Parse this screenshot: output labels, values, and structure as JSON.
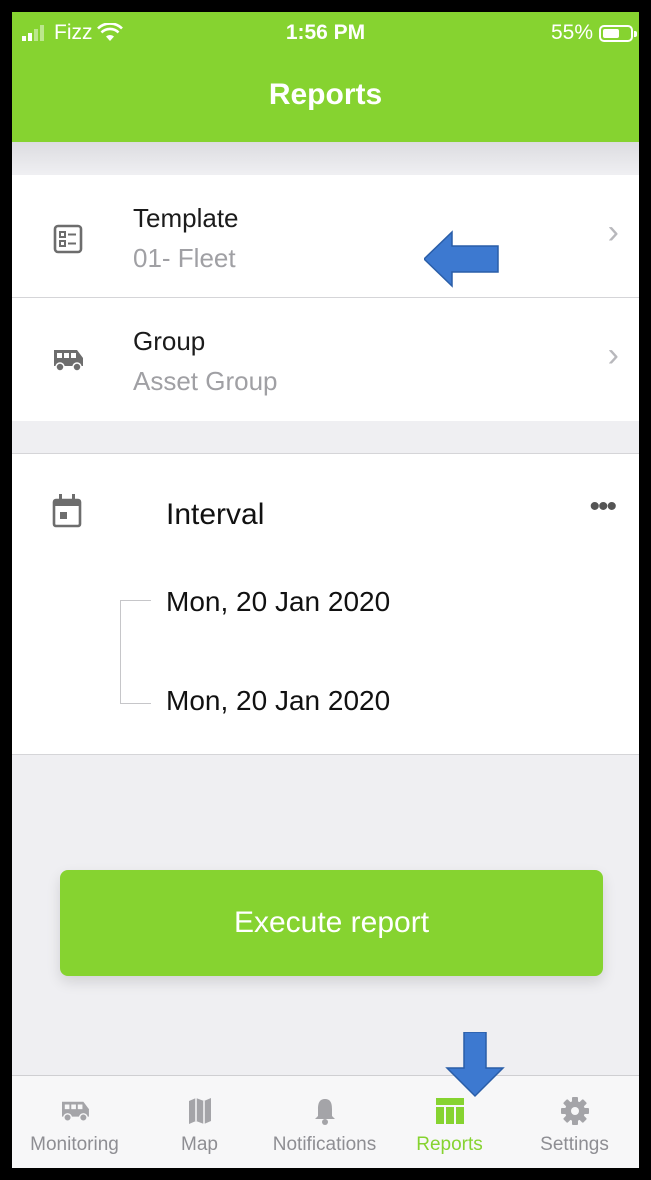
{
  "status_bar": {
    "carrier": "Fizz",
    "time": "1:56 PM",
    "battery": "55%"
  },
  "header": {
    "title": "Reports"
  },
  "rows": [
    {
      "title": "Template",
      "value": "01- Fleet",
      "icon": "template-list-icon"
    },
    {
      "title": "Group",
      "value": "Asset Group",
      "icon": "van-icon"
    }
  ],
  "interval": {
    "label": "Interval",
    "icon": "calendar-icon",
    "start": "Mon, 20 Jan 2020",
    "end": "Mon, 20 Jan 2020"
  },
  "execute_button": "Execute report",
  "tabs": [
    {
      "label": "Monitoring",
      "icon": "van-icon",
      "active": false
    },
    {
      "label": "Map",
      "icon": "map-icon",
      "active": false
    },
    {
      "label": "Notifications",
      "icon": "bell-icon",
      "active": false
    },
    {
      "label": "Reports",
      "icon": "table-icon",
      "active": true
    },
    {
      "label": "Settings",
      "icon": "gear-icon",
      "active": false
    }
  ],
  "colors": {
    "accent": "#86d330",
    "annotation_arrow": "#3d79d0"
  }
}
